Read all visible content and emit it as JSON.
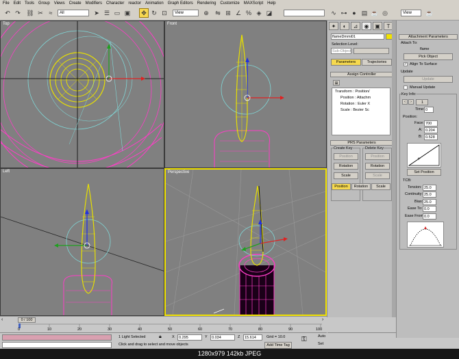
{
  "menu": [
    "File",
    "Edit",
    "Tools",
    "Group",
    "Views",
    "Create",
    "Modifiers",
    "Character",
    "reactor",
    "Animation",
    "Graph Editors",
    "Rendering",
    "Customize",
    "MAXScript",
    "Help"
  ],
  "toolbar": {
    "selection_filter": "All",
    "ref_coord": "View",
    "right_view": "View"
  },
  "viewports": {
    "top": "Top",
    "front": "Front",
    "left": "Left",
    "perspective": "Perspective"
  },
  "command_panel": {
    "object_name": "flameDmmi01",
    "selection_level_label": "Selection Level:",
    "sub_object": "Sub-Object",
    "tab_parameters": "Parameters",
    "tab_trajectories": "Trajectories",
    "assign_controller": "Assign Controller",
    "tree": [
      "Transform : Position/",
      "Position : Attachm",
      "Rotation : Euler X",
      "Scale : Bezier Sc"
    ],
    "prs_title": "PRS Parameters",
    "create_key": "Create Key",
    "delete_key": "Delete Key",
    "create_buttons": [
      "Position",
      "Rotation",
      "Scale"
    ],
    "delete_buttons": [
      "Position",
      "Rotation",
      "Scale"
    ],
    "bottom_tabs": [
      "Position",
      "Rotation",
      "Scale"
    ]
  },
  "attachment": {
    "title": "Attachment Parameters",
    "attach_to": "Attach To:",
    "target": "flame",
    "pick_object": "Pick Object",
    "align_to_surface": "Align To Surface",
    "align_checked": true,
    "update_label": "Update",
    "update_button": "Update",
    "manual_update": "Manual Update",
    "key_info": "Key Info:",
    "key_index": "1",
    "time_label": "Time:",
    "time_value": "0",
    "position_label": "Position:",
    "face_label": "Face:",
    "face_value": "700",
    "a_label": "A:",
    "a_value": "0.204",
    "b_label": "B:",
    "b_value": "0.528",
    "set_position": "Set Position",
    "tcb_label": "TCB:",
    "tension_label": "Tension:",
    "tension_value": "25.0",
    "continuity_label": "Continuity:",
    "continuity_value": "25.0",
    "bias_label": "Bias:",
    "bias_value": "25.0",
    "ease_to_label": "Ease To:",
    "ease_to_value": "0.0",
    "ease_from_label": "Ease From:",
    "ease_from_value": "0.0"
  },
  "timeline": {
    "frame": "0 / 100",
    "ticks": [
      "0",
      "10",
      "20",
      "30",
      "40",
      "50",
      "60",
      "70",
      "80",
      "90",
      "100"
    ]
  },
  "status": {
    "selected": "1 Light Selected",
    "prompt": "Click and drag to select and move objects",
    "x_label": "X",
    "x_value": "0.295",
    "y_label": "Y",
    "y_value": "0.034",
    "z_label": "Z",
    "z_value": "15.614",
    "grid": "Grid = 10.0",
    "add_time_tag": "Add Time Tag",
    "auto": "Auto",
    "set": "Set"
  },
  "caption": "1280x979  142kb  JPEG",
  "colors": {
    "active_border": "#f2e300",
    "button_active": "#f6d94e",
    "wire_yellow": "#e8e000",
    "wire_pink": "#ff3cc8"
  }
}
